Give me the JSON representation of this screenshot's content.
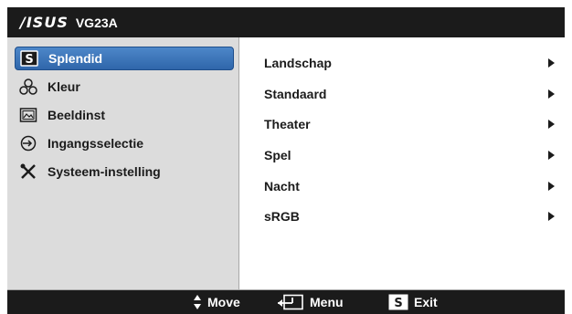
{
  "header": {
    "brand_logo": "/ISUS",
    "model": "VG23A"
  },
  "sidebar": {
    "items": [
      {
        "label": "Splendid",
        "icon": "splendid-s-icon",
        "active": true
      },
      {
        "label": "Kleur",
        "icon": "color-triangle-icon",
        "active": false
      },
      {
        "label": "Beeldinst",
        "icon": "image-icon",
        "active": false
      },
      {
        "label": "Ingangsselectie",
        "icon": "input-select-icon",
        "active": false
      },
      {
        "label": "Systeem-instelling",
        "icon": "tools-icon",
        "active": false
      }
    ]
  },
  "options": [
    {
      "label": "Landschap"
    },
    {
      "label": "Standaard"
    },
    {
      "label": "Theater"
    },
    {
      "label": "Spel"
    },
    {
      "label": "Nacht"
    },
    {
      "label": "sRGB"
    }
  ],
  "footer": {
    "move_label": "Move",
    "menu_label": "Menu",
    "exit_label": "Exit",
    "exit_key": "S"
  },
  "colors": {
    "accent": "#3a72b8",
    "bar": "#1b1b1b",
    "sidebar_bg": "#dcdcdc"
  }
}
